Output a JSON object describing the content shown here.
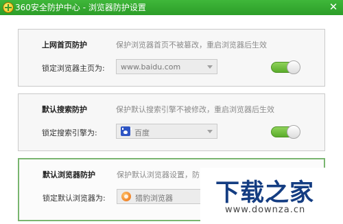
{
  "window": {
    "title": "360安全防护中心 - 浏览器防护设置",
    "close_glyph": "✕",
    "app_icon": "360-shield-icon"
  },
  "accent_color": "#2f9f2b",
  "panels": [
    {
      "heading": "上网首页防护",
      "description": "保护浏览器首页不被篡改，重启浏览器后生效",
      "field_label": "锁定浏览器主页为:",
      "selected_value": "www.baidu.com",
      "icon": null,
      "toggle_on": true
    },
    {
      "heading": "默认搜索防护",
      "description": "保护默认搜索引擎不被修改，重启浏览器后生效",
      "field_label": "锁定搜索引擎为:",
      "selected_value": "百度",
      "icon": "baidu-paw-icon",
      "toggle_on": true
    },
    {
      "heading": "默认浏览器防护",
      "description": "保护默认浏览器设置，防",
      "field_label": "锁定默认浏览器为:",
      "selected_value": "猎豹浏览器",
      "icon": "cheetah-browser-icon",
      "toggle_on": null
    }
  ],
  "watermark": {
    "main": "下载之家",
    "url": "www.downza.cn"
  }
}
